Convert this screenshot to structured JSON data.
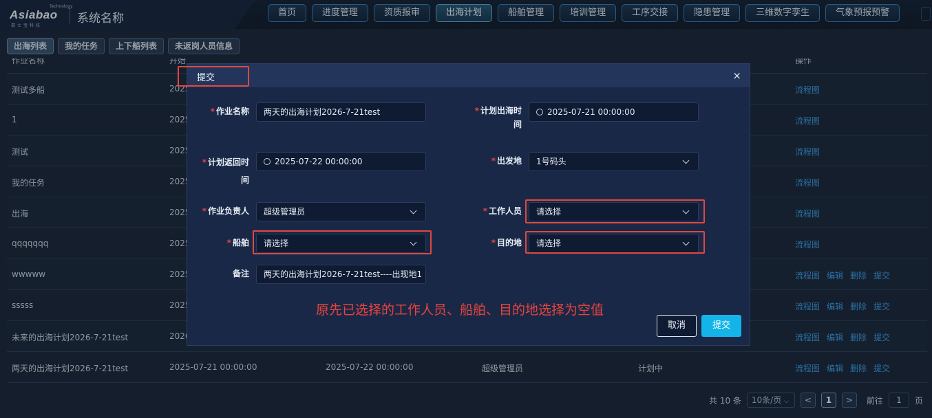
{
  "app": {
    "logo_brand": "Asiabao",
    "logo_tech": "Technology",
    "logo_sub": "慕士宝科技",
    "system_name": "系统名称"
  },
  "nav": [
    "首页",
    "进度管理",
    "资质报审",
    "出海计划",
    "船舶管理",
    "培训管理",
    "工序交接",
    "隐患管理",
    "三维数字孪生",
    "气象预报预警"
  ],
  "nav_active": "出海计划",
  "subtabs": [
    "出海列表",
    "我的任务",
    "上下船列表",
    "未返岗人员信息"
  ],
  "subtab_active": "出海列表",
  "table": {
    "headers": [
      "作业名称",
      "开始",
      "",
      "",
      "",
      "操作"
    ],
    "rows": [
      {
        "name": "测试多船",
        "start": "2025",
        "end": "",
        "owner": "",
        "status": "",
        "ops": [
          "流程图"
        ]
      },
      {
        "name": "1",
        "start": "2025",
        "end": "",
        "owner": "",
        "status": "",
        "ops": [
          "流程图"
        ]
      },
      {
        "name": "测试",
        "start": "2025",
        "end": "",
        "owner": "",
        "status": "",
        "ops": [
          "流程图"
        ]
      },
      {
        "name": "我的任务",
        "start": "2025",
        "end": "",
        "owner": "",
        "status": "",
        "ops": [
          "流程图"
        ]
      },
      {
        "name": "出海",
        "start": "2025",
        "end": "",
        "owner": "",
        "status": "",
        "ops": [
          "流程图"
        ]
      },
      {
        "name": "qqqqqqq",
        "start": "2025",
        "end": "",
        "owner": "",
        "status": "",
        "ops": [
          "流程图"
        ]
      },
      {
        "name": "wwwww",
        "start": "2025",
        "end": "",
        "owner": "",
        "status": "",
        "ops": [
          "流程图",
          "编辑",
          "删除",
          "提交"
        ]
      },
      {
        "name": "sssss",
        "start": "2025",
        "end": "",
        "owner": "",
        "status": "",
        "ops": [
          "流程图",
          "编辑",
          "删除",
          "提交"
        ]
      },
      {
        "name": "未来的出海计划2026-7-21test",
        "start": "2026",
        "end": "",
        "owner": "",
        "status": "",
        "ops": [
          "流程图",
          "编辑",
          "删除",
          "提交"
        ]
      },
      {
        "name": "两天的出海计划2026-7-21test",
        "start": "2025-07-21 00:00:00",
        "end": "2025-07-22 00:00:00",
        "owner": "超级管理员",
        "status": "计划中",
        "ops": [
          "流程图",
          "编辑",
          "删除",
          "提交"
        ]
      }
    ]
  },
  "pager": {
    "total": "共 10 条",
    "page_size": "10条/页",
    "prev": "<",
    "current": "1",
    "next": ">",
    "goto_prefix": "前往",
    "goto_value": "1",
    "goto_suffix": "页"
  },
  "modal": {
    "title": "提交",
    "close": "×",
    "fields": {
      "job_name": {
        "label": "作业名称",
        "required": "*",
        "value": "两天的出海计划2026-7-21test"
      },
      "plan_depart_time": {
        "label_line1": "计划出海时",
        "label_line2": "间",
        "required": "*",
        "value": "2025-07-21 00:00:00"
      },
      "plan_return_time": {
        "label_line1": "计划返回时",
        "label_line2": "间",
        "required": "*",
        "value": "2025-07-22 00:00:00"
      },
      "depart_place": {
        "label": "出发地",
        "required": "*",
        "value": "1号码头"
      },
      "leader": {
        "label": "作业负责人",
        "required": "*",
        "value": "超级管理员"
      },
      "workers": {
        "label": "工作人员",
        "required": "*",
        "value": "请选择"
      },
      "ship": {
        "label": "船舶",
        "required": "*",
        "value": "请选择"
      },
      "destination": {
        "label": "目的地",
        "required": "*",
        "value": "请选择"
      },
      "remark": {
        "label": "备注",
        "value": "两天的出海计划2026-7-21test----出现地1"
      }
    },
    "annotation": "原先已选择的工作人员、船舶、目的地选择为空值",
    "cancel_label": "取消",
    "submit_label": "提交"
  },
  "colors": {
    "highlight": "#e0473f",
    "accent": "#14b4e8",
    "link": "#3c9be0"
  }
}
